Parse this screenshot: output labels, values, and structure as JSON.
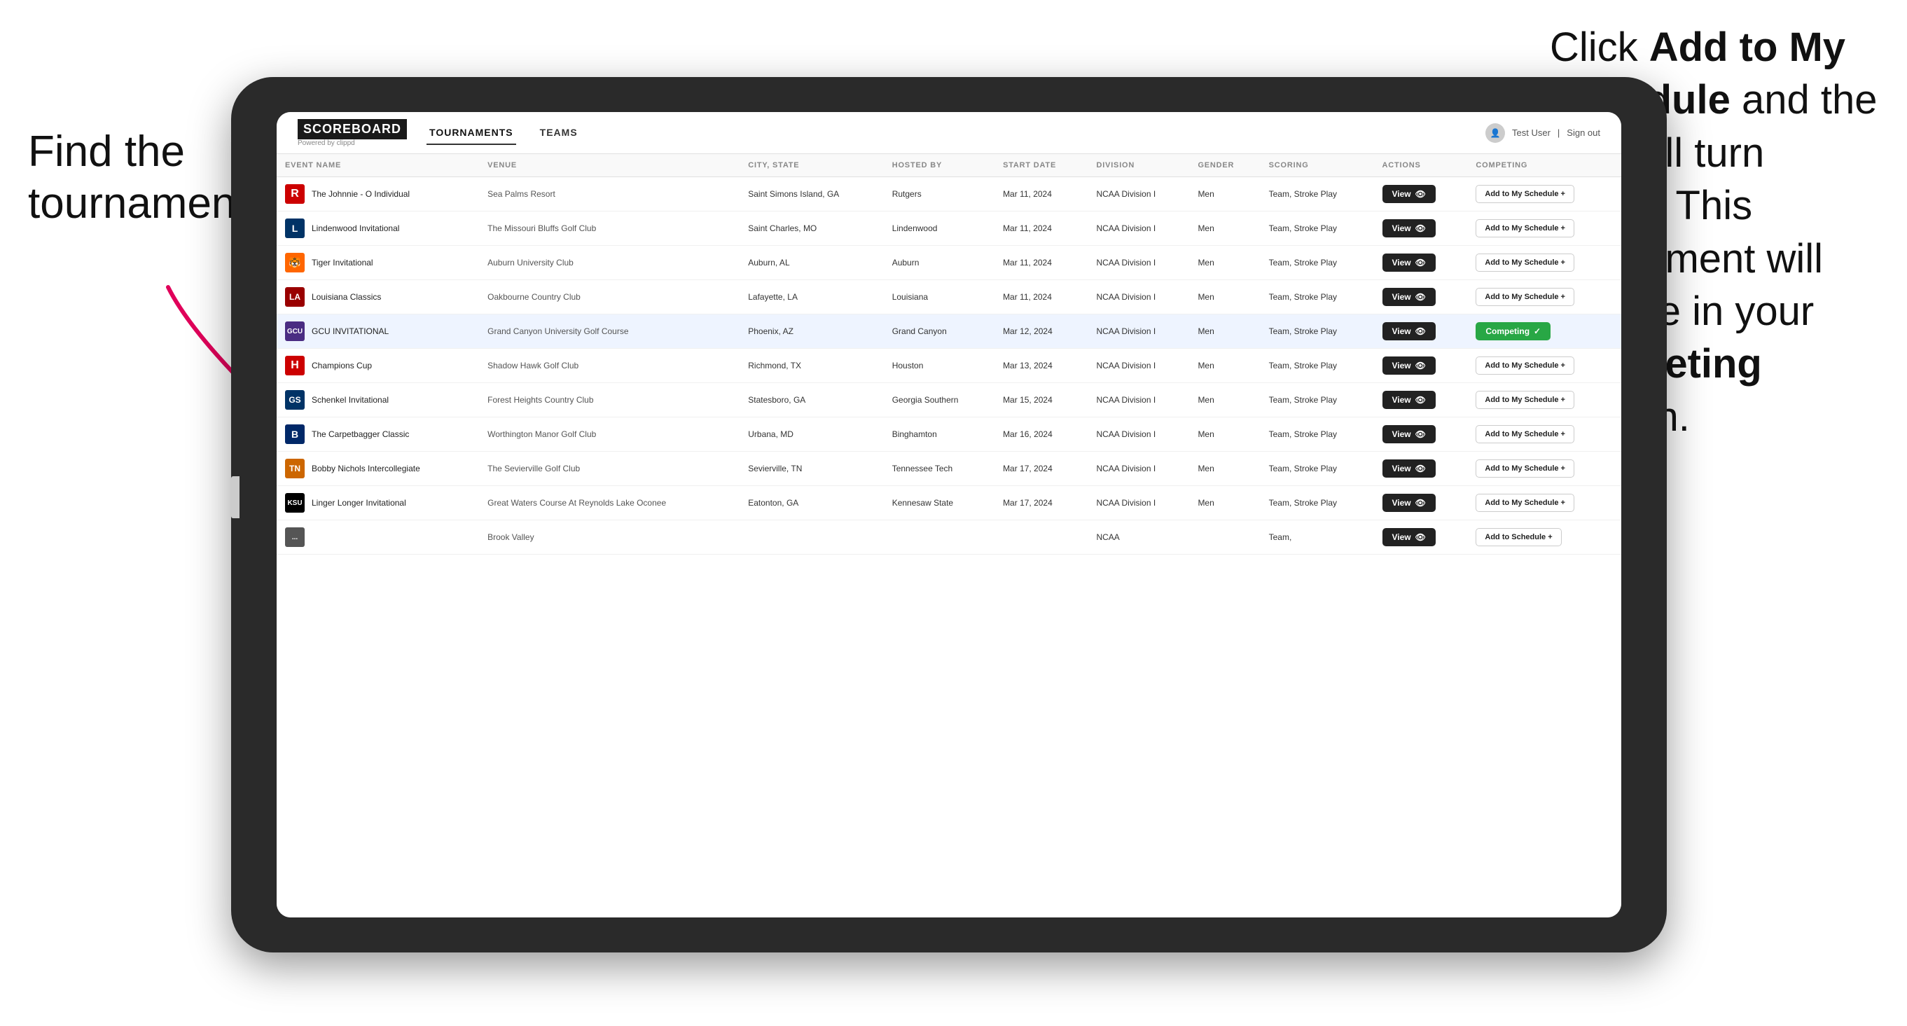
{
  "instructions": {
    "left_text": "Find the tournament.",
    "right_line1": "Click ",
    "right_bold1": "Add to My Schedule",
    "right_line2": " and the box will turn green. This tournament will now be in your ",
    "right_bold2": "Competing",
    "right_line3": " section."
  },
  "header": {
    "logo": "SCOREBOARD",
    "logo_sub": "Powered by clippd",
    "nav_items": [
      "TOURNAMENTS",
      "TEAMS"
    ],
    "active_nav": "TOURNAMENTS",
    "user": "Test User",
    "signout": "Sign out"
  },
  "table": {
    "columns": [
      "EVENT NAME",
      "VENUE",
      "CITY, STATE",
      "HOSTED BY",
      "START DATE",
      "DIVISION",
      "GENDER",
      "SCORING",
      "ACTIONS",
      "COMPETING"
    ],
    "rows": [
      {
        "id": 1,
        "logo_class": "logo-r",
        "logo_text": "R",
        "event_name": "The Johnnie - O Individual",
        "venue": "Sea Palms Resort",
        "city_state": "Saint Simons Island, GA",
        "hosted_by": "Rutgers",
        "start_date": "Mar 11, 2024",
        "division": "NCAA Division I",
        "gender": "Men",
        "scoring": "Team, Stroke Play",
        "action": "View",
        "competing": "Add to My Schedule +",
        "is_competing": false,
        "highlighted": false
      },
      {
        "id": 2,
        "logo_class": "logo-l",
        "logo_text": "L",
        "event_name": "Lindenwood Invitational",
        "venue": "The Missouri Bluffs Golf Club",
        "city_state": "Saint Charles, MO",
        "hosted_by": "Lindenwood",
        "start_date": "Mar 11, 2024",
        "division": "NCAA Division I",
        "gender": "Men",
        "scoring": "Team, Stroke Play",
        "action": "View",
        "competing": "Add to My Schedule +",
        "is_competing": false,
        "highlighted": false
      },
      {
        "id": 3,
        "logo_class": "logo-t",
        "logo_text": "🐯",
        "event_name": "Tiger Invitational",
        "venue": "Auburn University Club",
        "city_state": "Auburn, AL",
        "hosted_by": "Auburn",
        "start_date": "Mar 11, 2024",
        "division": "NCAA Division I",
        "gender": "Men",
        "scoring": "Team, Stroke Play",
        "action": "View",
        "competing": "Add to My Schedule +",
        "is_competing": false,
        "highlighted": false
      },
      {
        "id": 4,
        "logo_class": "logo-la",
        "logo_text": "LA",
        "event_name": "Louisiana Classics",
        "venue": "Oakbourne Country Club",
        "city_state": "Lafayette, LA",
        "hosted_by": "Louisiana",
        "start_date": "Mar 11, 2024",
        "division": "NCAA Division I",
        "gender": "Men",
        "scoring": "Team, Stroke Play",
        "action": "View",
        "competing": "Add to My Schedule +",
        "is_competing": false,
        "highlighted": false
      },
      {
        "id": 5,
        "logo_class": "logo-gcu",
        "logo_text": "GCU",
        "event_name": "GCU INVITATIONAL",
        "venue": "Grand Canyon University Golf Course",
        "city_state": "Phoenix, AZ",
        "hosted_by": "Grand Canyon",
        "start_date": "Mar 12, 2024",
        "division": "NCAA Division I",
        "gender": "Men",
        "scoring": "Team, Stroke Play",
        "action": "View",
        "competing": "Competing ✓",
        "is_competing": true,
        "highlighted": true
      },
      {
        "id": 6,
        "logo_class": "logo-h",
        "logo_text": "H",
        "event_name": "Champions Cup",
        "venue": "Shadow Hawk Golf Club",
        "city_state": "Richmond, TX",
        "hosted_by": "Houston",
        "start_date": "Mar 13, 2024",
        "division": "NCAA Division I",
        "gender": "Men",
        "scoring": "Team, Stroke Play",
        "action": "View",
        "competing": "Add to My Schedule +",
        "is_competing": false,
        "highlighted": false
      },
      {
        "id": 7,
        "logo_class": "logo-gs",
        "logo_text": "GS",
        "event_name": "Schenkel Invitational",
        "venue": "Forest Heights Country Club",
        "city_state": "Statesboro, GA",
        "hosted_by": "Georgia Southern",
        "start_date": "Mar 15, 2024",
        "division": "NCAA Division I",
        "gender": "Men",
        "scoring": "Team, Stroke Play",
        "action": "View",
        "competing": "Add to My Schedule +",
        "is_competing": false,
        "highlighted": false
      },
      {
        "id": 8,
        "logo_class": "logo-b",
        "logo_text": "B",
        "event_name": "The Carpetbagger Classic",
        "venue": "Worthington Manor Golf Club",
        "city_state": "Urbana, MD",
        "hosted_by": "Binghamton",
        "start_date": "Mar 16, 2024",
        "division": "NCAA Division I",
        "gender": "Men",
        "scoring": "Team, Stroke Play",
        "action": "View",
        "competing": "Add to My Schedule +",
        "is_competing": false,
        "highlighted": false
      },
      {
        "id": 9,
        "logo_class": "logo-tn",
        "logo_text": "TN",
        "event_name": "Bobby Nichols Intercollegiate",
        "venue": "The Sevierville Golf Club",
        "city_state": "Sevierville, TN",
        "hosted_by": "Tennessee Tech",
        "start_date": "Mar 17, 2024",
        "division": "NCAA Division I",
        "gender": "Men",
        "scoring": "Team, Stroke Play",
        "action": "View",
        "competing": "Add to My Schedule +",
        "is_competing": false,
        "highlighted": false
      },
      {
        "id": 10,
        "logo_class": "logo-ksu",
        "logo_text": "KSU",
        "event_name": "Linger Longer Invitational",
        "venue": "Great Waters Course At Reynolds Lake Oconee",
        "city_state": "Eatonton, GA",
        "hosted_by": "Kennesaw State",
        "start_date": "Mar 17, 2024",
        "division": "NCAA Division I",
        "gender": "Men",
        "scoring": "Team, Stroke Play",
        "action": "View",
        "competing": "Add to My Schedule +",
        "is_competing": false,
        "highlighted": false
      },
      {
        "id": 11,
        "logo_class": "logo-last",
        "logo_text": "...",
        "event_name": "",
        "venue": "Brook Valley",
        "city_state": "",
        "hosted_by": "",
        "start_date": "",
        "division": "NCAA",
        "gender": "",
        "scoring": "Team,",
        "action": "View",
        "competing": "Add to Schedule +",
        "is_competing": false,
        "highlighted": false
      }
    ]
  }
}
